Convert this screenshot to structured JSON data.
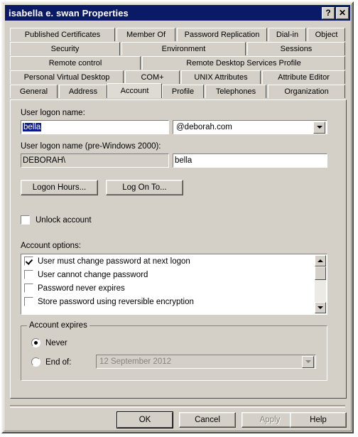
{
  "window": {
    "title": "isabella e. swan Properties",
    "help_button": "?",
    "close_button": "✕"
  },
  "tabs": {
    "rows": [
      [
        {
          "label": "Published Certificates",
          "selected": false
        },
        {
          "label": "Member Of",
          "selected": false
        },
        {
          "label": "Password Replication",
          "selected": false
        },
        {
          "label": "Dial-in",
          "selected": false
        },
        {
          "label": "Object",
          "selected": false
        }
      ],
      [
        {
          "label": "Security",
          "selected": false
        },
        {
          "label": "Environment",
          "selected": false
        },
        {
          "label": "Sessions",
          "selected": false
        }
      ],
      [
        {
          "label": "Remote control",
          "selected": false
        },
        {
          "label": "Remote Desktop Services Profile",
          "selected": false
        }
      ],
      [
        {
          "label": "Personal Virtual Desktop",
          "selected": false
        },
        {
          "label": "COM+",
          "selected": false
        },
        {
          "label": "UNIX Attributes",
          "selected": false
        },
        {
          "label": "Attribute Editor",
          "selected": false
        }
      ],
      [
        {
          "label": "General",
          "selected": false
        },
        {
          "label": "Address",
          "selected": false
        },
        {
          "label": "Account",
          "selected": true
        },
        {
          "label": "Profile",
          "selected": false
        },
        {
          "label": "Telephones",
          "selected": false
        },
        {
          "label": "Organization",
          "selected": false
        }
      ]
    ]
  },
  "account": {
    "logon_name_label": "User logon name:",
    "logon_name_value": "bella",
    "upn_suffix_value": "@deborah.com",
    "pre2000_label": "User logon name (pre-Windows 2000):",
    "domain_value": "DEBORAH\\",
    "pre2000_value": "bella",
    "logon_hours_button": "Logon Hours...",
    "log_on_to_button": "Log On To...",
    "unlock_label": "Unlock account",
    "unlock_checked": false,
    "options_label": "Account options:",
    "options": [
      {
        "label": "User must change password at next logon",
        "checked": true
      },
      {
        "label": "User cannot change password",
        "checked": false
      },
      {
        "label": "Password never expires",
        "checked": false
      },
      {
        "label": "Store password using reversible encryption",
        "checked": false
      }
    ],
    "expires": {
      "legend": "Account expires",
      "never_label": "Never",
      "never_selected": true,
      "end_of_label": "End of:",
      "end_of_selected": false,
      "end_of_date": "12 September 2012"
    }
  },
  "footer": {
    "ok": "OK",
    "cancel": "Cancel",
    "apply": "Apply",
    "apply_disabled": true,
    "help": "Help"
  }
}
